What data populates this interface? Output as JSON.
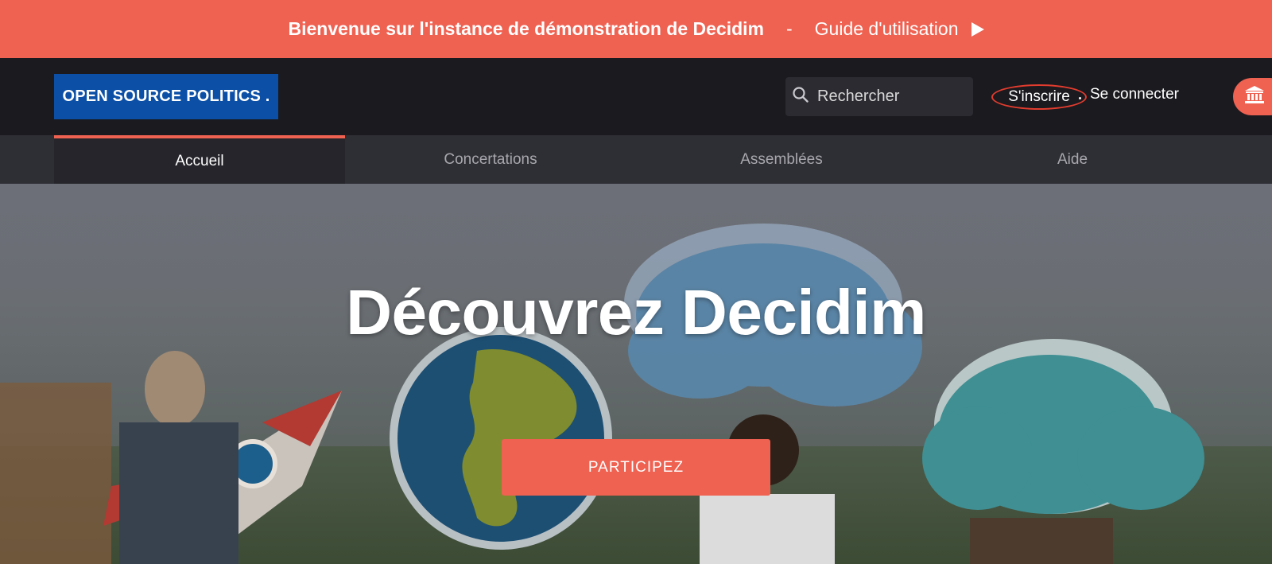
{
  "banner": {
    "welcome_text": "Bienvenue sur l'instance de démonstration de Decidim",
    "separator": "-",
    "guide_link": "Guide d'utilisation"
  },
  "header": {
    "logo_text": "OPEN SOURCE POLITICS .",
    "search_placeholder": "Rechercher",
    "signup_label": "S'inscrire",
    "login_label": "Se connecter"
  },
  "nav": {
    "tabs": [
      {
        "label": "Accueil",
        "active": true
      },
      {
        "label": "Concertations",
        "active": false
      },
      {
        "label": "Assemblées",
        "active": false
      },
      {
        "label": "Aide",
        "active": false
      }
    ]
  },
  "hero": {
    "title": "Découvrez Decidim",
    "cta_label": "PARTICIPEZ"
  },
  "colors": {
    "accent": "#ef6151",
    "logo_bg": "#0b4fa6",
    "header_bg": "#1a1a1f",
    "nav_bg": "#2e2e35"
  },
  "icons": [
    "search-icon",
    "play-icon",
    "institution-icon",
    "rocket-icon",
    "globe-icon",
    "cloud-icon"
  ]
}
